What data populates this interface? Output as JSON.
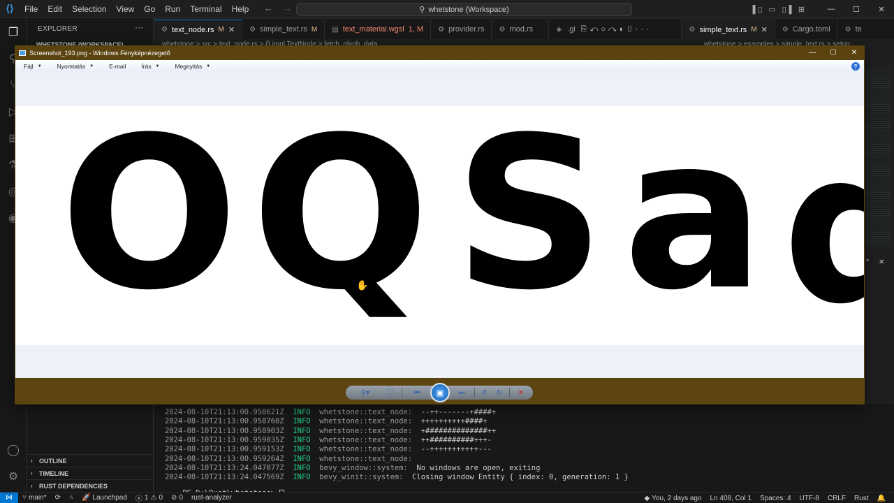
{
  "vscode": {
    "menu": [
      "File",
      "Edit",
      "Selection",
      "View",
      "Go",
      "Run",
      "Terminal",
      "Help"
    ],
    "search_text": "whetstone (Workspace)",
    "explorer_title": "EXPLORER",
    "workspace_label": "WHETSTONE (WORKSPACE)",
    "sections": {
      "outline": "OUTLINE",
      "timeline": "TIMELINE",
      "rust_deps": "RUST DEPENDENCIES"
    },
    "tabs_left": [
      {
        "name": "text_node.rs",
        "mark": "M"
      },
      {
        "name": "simple_text.rs",
        "mark": "M"
      },
      {
        "name": "text_material.wgsl",
        "mark": "1, M"
      },
      {
        "name": "provider.rs",
        "mark": ""
      },
      {
        "name": "mod.rs",
        "mark": ""
      }
    ],
    "tabs_right": [
      {
        "name": "simple_text.rs",
        "mark": "M"
      },
      {
        "name": "Cargo.toml",
        "mark": ""
      },
      {
        "name": "te",
        "mark": ""
      }
    ],
    "tab_partial": ".gi",
    "breadcrumb_left": "whetstone > src > text_node.rs > {} impl TextNode > fetch_glyph_data",
    "breadcrumb_right": "whetstone > examples > simple_text.rs > setup",
    "terminal_lines": [
      {
        "ts": "2024-08-10T21:13:00.958621Z",
        "level": "INFO",
        "module": "whetstone::text_node:",
        "msg": "--++-------+####+"
      },
      {
        "ts": "2024-08-10T21:13:00.958760Z",
        "level": "INFO",
        "module": "whetstone::text_node:",
        "msg": "++++++++++####+"
      },
      {
        "ts": "2024-08-10T21:13:00.958903Z",
        "level": "INFO",
        "module": "whetstone::text_node:",
        "msg": "+##############++"
      },
      {
        "ts": "2024-08-10T21:13:00.959035Z",
        "level": "INFO",
        "module": "whetstone::text_node:",
        "msg": "++##########+++-"
      },
      {
        "ts": "2024-08-10T21:13:00.959153Z",
        "level": "INFO",
        "module": "whetstone::text_node:",
        "msg": "--+++++++++++---"
      },
      {
        "ts": "2024-08-10T21:13:00.959264Z",
        "level": "INFO",
        "module": "whetstone::text_node:",
        "msg": ""
      },
      {
        "ts": "2024-08-10T21:13:24.047077Z",
        "level": "INFO",
        "module": "bevy_window::system:",
        "msg": "No windows are open, exiting"
      },
      {
        "ts": "2024-08-10T21:13:24.047569Z",
        "level": "INFO",
        "module": "bevy_winit::system:",
        "msg": "Closing window Entity { index: 0, generation: 1 }"
      }
    ],
    "prompt": "PS D:\\Rust\\whetstone> ",
    "status": {
      "branch": "main*",
      "launchpad": "Launchpad",
      "errors": "1",
      "warnings": "0",
      "ports": "0",
      "analyzer": "rust-analyzer",
      "blame": "You, 2 days ago",
      "position": "Ln 408, Col 1",
      "spaces": "Spaces: 4",
      "encoding": "UTF-8",
      "eol": "CRLF",
      "language": "Rust"
    }
  },
  "viewer": {
    "title": "Screenshot_193.png - Windows Fényképnézegető",
    "menu": [
      "Fájl",
      "Nyomtatás",
      "E-mail",
      "Írás",
      "Megnyitás"
    ],
    "menu_has_arrow": [
      true,
      true,
      false,
      true,
      true
    ],
    "glyphs": [
      "O",
      "Q",
      "S",
      "a",
      "d"
    ],
    "colors": {
      "frame": "#5c4511",
      "canvas": "#edf1f8",
      "image_bg": "#ffffff"
    }
  }
}
